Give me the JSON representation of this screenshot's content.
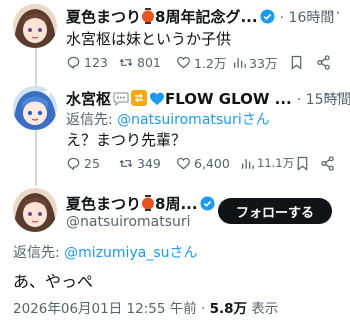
{
  "tweet1": {
    "name": "夏色まつり",
    "name_suffix": "8周年記念グ...",
    "time": "· 16時間",
    "text": "水宮枢は妹というか子供",
    "replies": "123",
    "retweets": "801",
    "likes": "1.2万",
    "views": "33万"
  },
  "tweet2": {
    "name": "水宮枢",
    "name_suffix": "FLOW GLOW ...",
    "time": "· 15時間",
    "reply_prefix": "返信先: ",
    "reply_handle": "@natsuiromatsuri",
    "reply_suffix": "さん",
    "text": "え？まつり先輩？",
    "replies": "25",
    "retweets": "349",
    "likes": "6,400",
    "views": "11.1万"
  },
  "tweet3": {
    "name": "夏色まつり",
    "name_suffix": "8周...",
    "handle": "@natsuiromatsuri",
    "follow_label": "フォローする",
    "reply_prefix": "返信先: ",
    "reply_handle": "@mizumiya_su",
    "reply_suffix": "さん",
    "text": "あ、やっぺ",
    "timestamp": "2026年06月01日 12:55 午前 · ",
    "views_count": "5.8万",
    "views_label": " 表示"
  },
  "colors": {
    "accent": "#1d9bf0",
    "verified": "#1d9bf0",
    "text_primary": "#0f1419",
    "text_secondary": "#536471"
  }
}
